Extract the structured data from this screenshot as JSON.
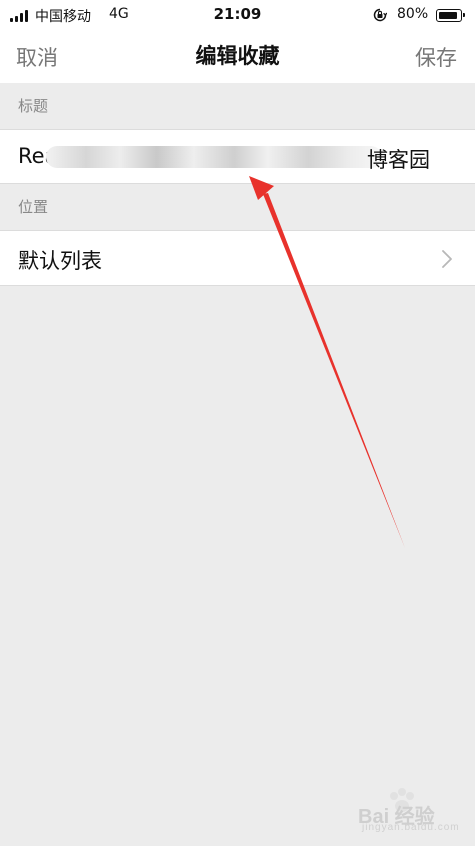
{
  "status_bar": {
    "carrier": "中国移动",
    "network": "4G",
    "time": "21:09",
    "battery_percent": "80%",
    "battery_level": 0.8,
    "signal_bars": 4
  },
  "nav": {
    "left_label": "取消",
    "title": "编辑收藏",
    "right_label": "保存"
  },
  "sections": {
    "title_header": "标题",
    "title_value_prefix": "Rea",
    "title_value_suffix": "博客园",
    "location_header": "位置",
    "location_value": "默认列表"
  },
  "watermark": {
    "brand": "Bai 经验",
    "url": "jingyan.baidu.com"
  },
  "colors": {
    "annotation_arrow": "#e8322c",
    "secondary_text": "#888888",
    "background": "#ececec"
  },
  "icons": {
    "chevron": "chevron-right-icon",
    "rotation_lock": "rotation-lock-icon",
    "battery": "battery-icon",
    "signal": "signal-icon"
  }
}
